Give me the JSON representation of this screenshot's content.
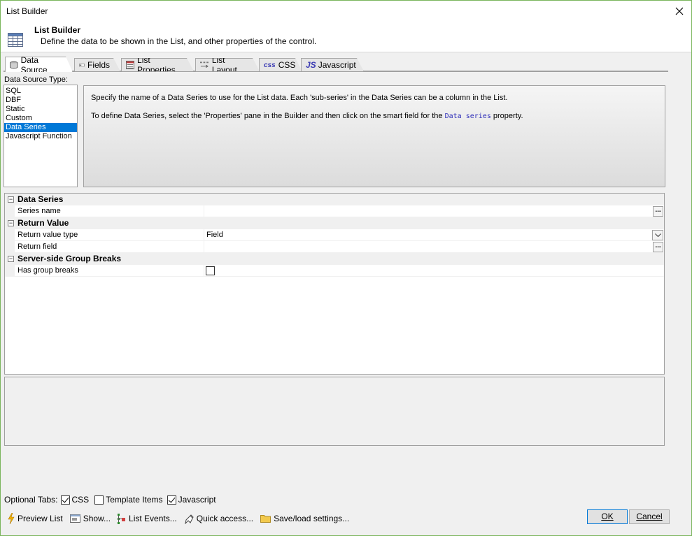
{
  "window": {
    "title": "List Builder"
  },
  "header": {
    "title": "List Builder",
    "subtitle": "Define the data to be shown in the List, and other properties of the control."
  },
  "tabs": [
    {
      "label": "Data Source",
      "icon": "database-icon",
      "active": true
    },
    {
      "label": "Fields",
      "icon": "field-icon",
      "active": false
    },
    {
      "label": "List Properties",
      "icon": "properties-icon",
      "active": false
    },
    {
      "label": "List Layout",
      "icon": "layout-icon",
      "active": false
    },
    {
      "label": "CSS",
      "icon": "css-icon",
      "icon_text": "css",
      "active": false
    },
    {
      "label": "Javascript",
      "icon": "js-icon",
      "icon_text": "JS",
      "active": false
    }
  ],
  "data_source": {
    "label": "Data Source Type:",
    "items": [
      "SQL",
      "DBF",
      "Static",
      "Custom",
      "Data Series",
      "Javascript Function"
    ],
    "selected": "Data Series"
  },
  "info": {
    "line1": "Specify the name of a Data Series to use for the List data. Each 'sub-series' in the Data Series can be a column in the List.",
    "line2_pre": "To define Data Series, select the 'Properties' pane in the Builder and then click on the smart field for the",
    "line2_code": "Data series",
    "line2_post": "property."
  },
  "property_grid": {
    "categories": [
      {
        "name": "Data Series",
        "toggle": "⊟",
        "properties": [
          {
            "name": "Series name",
            "value": "",
            "editor": "ellipsis"
          }
        ]
      },
      {
        "name": "Return Value",
        "toggle": "⊟",
        "properties": [
          {
            "name": "Return value type",
            "value": "Field",
            "editor": "dropdown"
          },
          {
            "name": "Return field",
            "value": "",
            "editor": "ellipsis"
          }
        ]
      },
      {
        "name": "Server-side Group Breaks",
        "toggle": "⊟",
        "properties": [
          {
            "name": "Has group breaks",
            "value": "",
            "editor": "checkbox",
            "checked": false
          }
        ]
      }
    ],
    "ellipsis_label": "..."
  },
  "optional_tabs": {
    "label": "Optional Tabs:",
    "items": [
      {
        "label": "CSS",
        "checked": true
      },
      {
        "label": "Template Items",
        "checked": false
      },
      {
        "label": "Javascript",
        "checked": true
      }
    ]
  },
  "toolbar": [
    {
      "label": "Preview List",
      "icon": "lightning-icon"
    },
    {
      "label": "Show...",
      "icon": "show-icon"
    },
    {
      "label": "List Events...",
      "icon": "events-icon"
    },
    {
      "label": "Quick access...",
      "icon": "quick-access-icon"
    },
    {
      "label": "Save/load settings...",
      "icon": "folder-icon"
    }
  ],
  "buttons": {
    "ok": "OK",
    "cancel": "Cancel"
  },
  "colors": {
    "selection": "#0078d7",
    "window_border": "#7ab55c",
    "code": "#2d2db8"
  }
}
